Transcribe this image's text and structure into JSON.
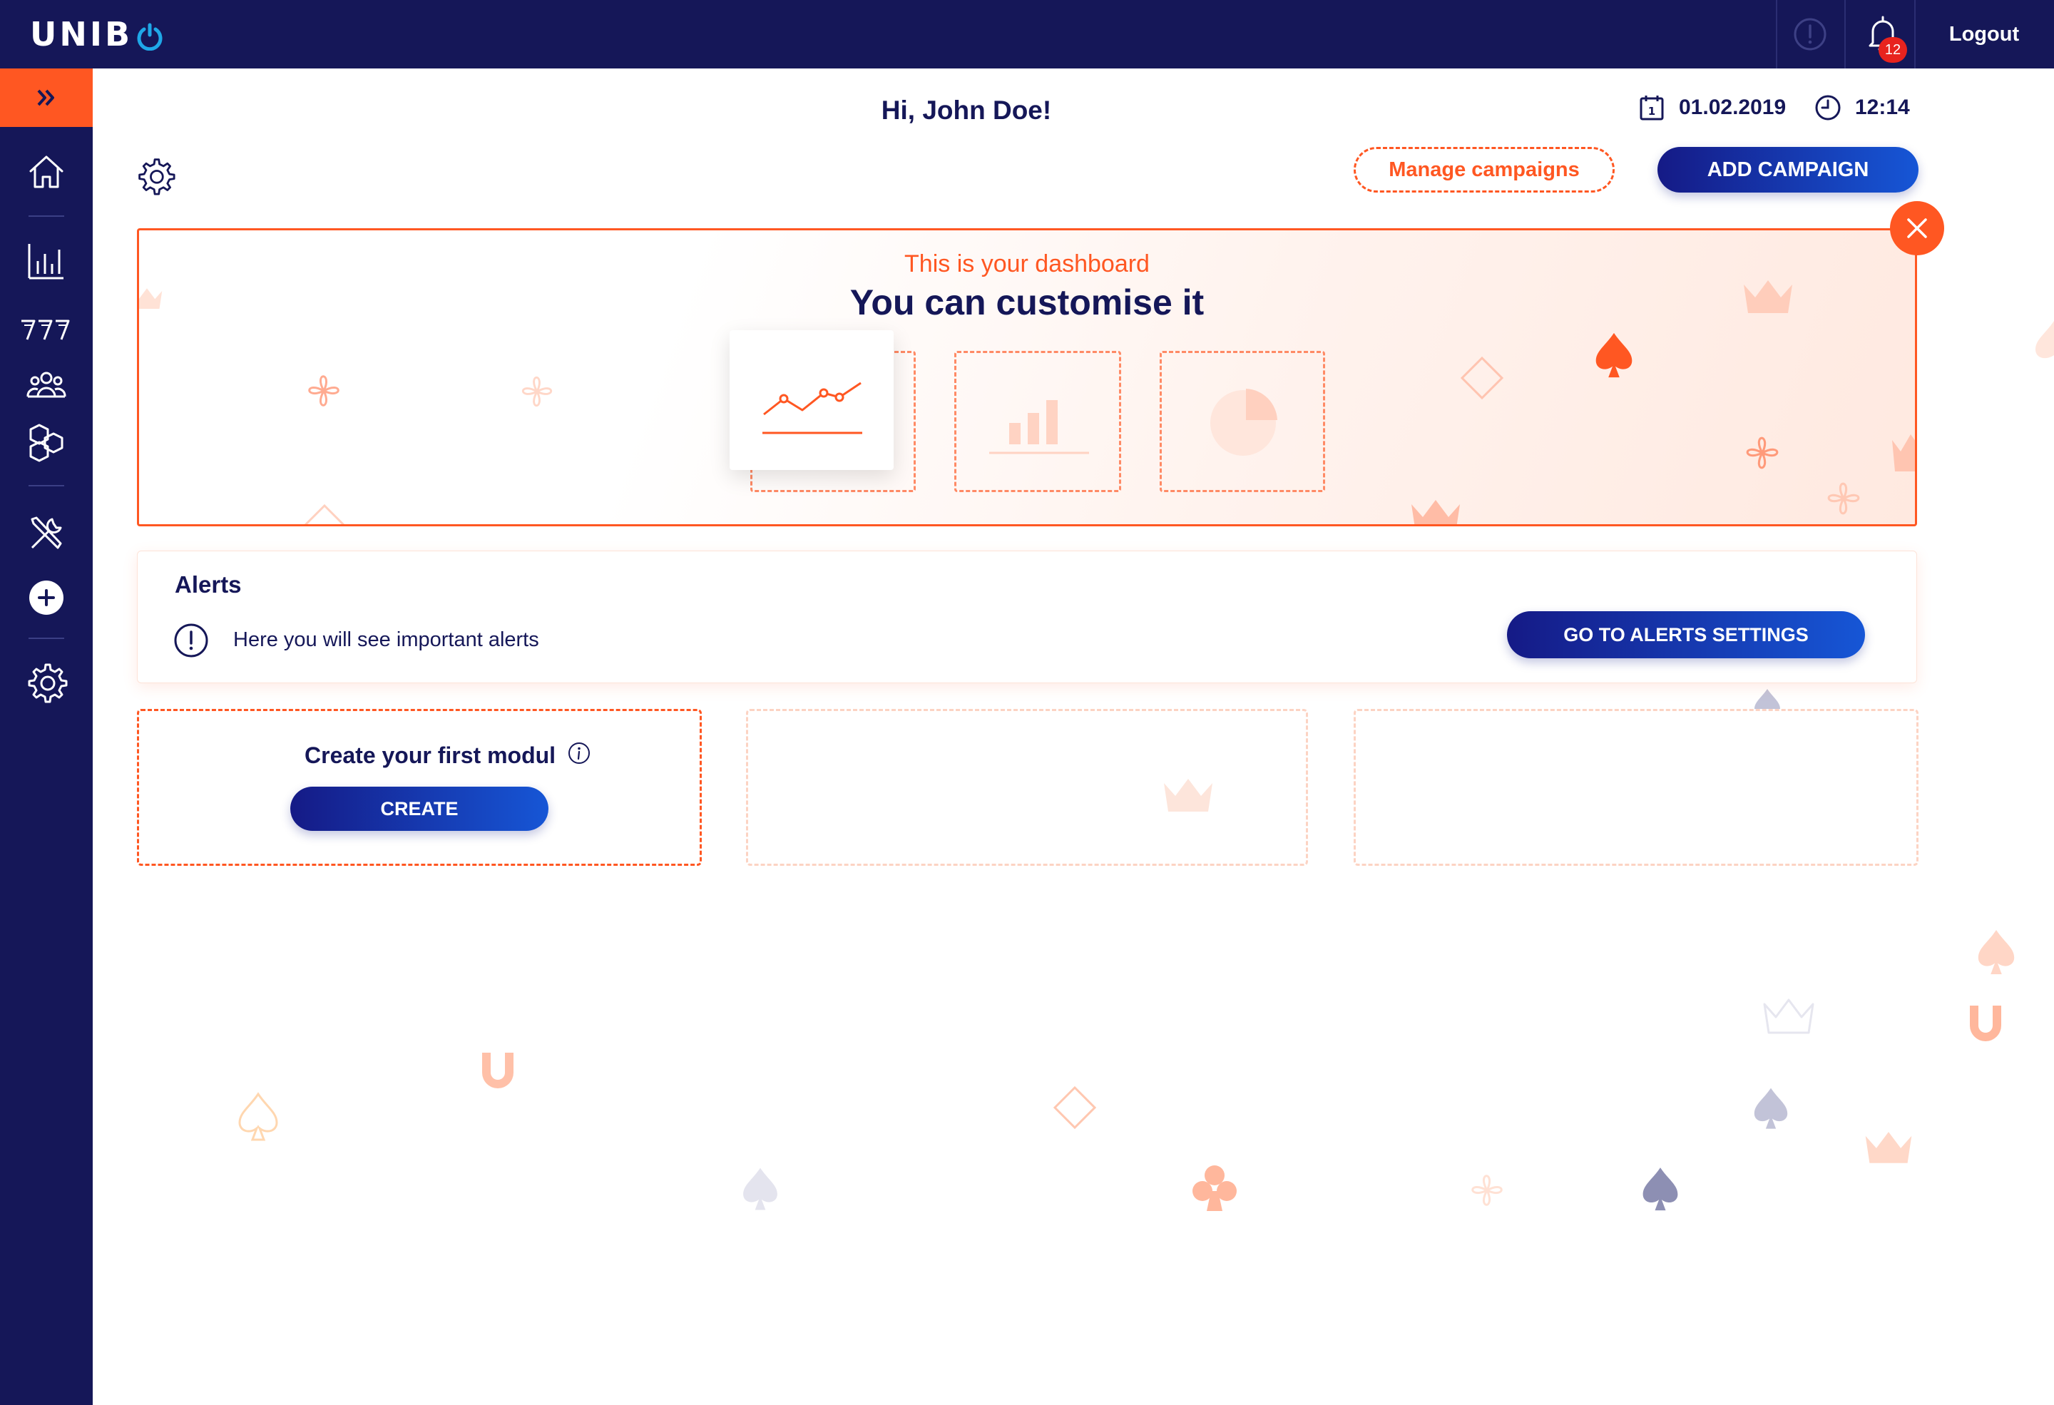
{
  "topbar": {
    "logo_text": "UNIB",
    "notification_count": "12",
    "logout_label": "Logout"
  },
  "header": {
    "greeting": "Hi, John Doe!",
    "date": "01.02.2019",
    "time": "12:14",
    "manage_campaigns_label": "Manage campaigns",
    "add_campaign_label": "ADD CAMPAIGN"
  },
  "banner": {
    "subtitle": "This is your dashboard",
    "title": "You can customise it"
  },
  "alerts": {
    "title": "Alerts",
    "message": "Here you will see important alerts",
    "settings_button": "GO TO ALERTS SETTINGS"
  },
  "module": {
    "title": "Create your first modul",
    "create_button": "CREATE"
  },
  "sidebar": {
    "items": [
      {
        "name": "home-icon"
      },
      {
        "name": "bar-chart-icon"
      },
      {
        "name": "slots-777-icon"
      },
      {
        "name": "users-icon"
      },
      {
        "name": "hexagons-icon"
      },
      {
        "name": "tools-icon"
      },
      {
        "name": "add-icon"
      },
      {
        "name": "settings-icon"
      }
    ]
  },
  "colors": {
    "navy": "#151758",
    "accent": "#ff5722",
    "button_blue": "#1656d6",
    "badge_red": "#e8231e"
  }
}
